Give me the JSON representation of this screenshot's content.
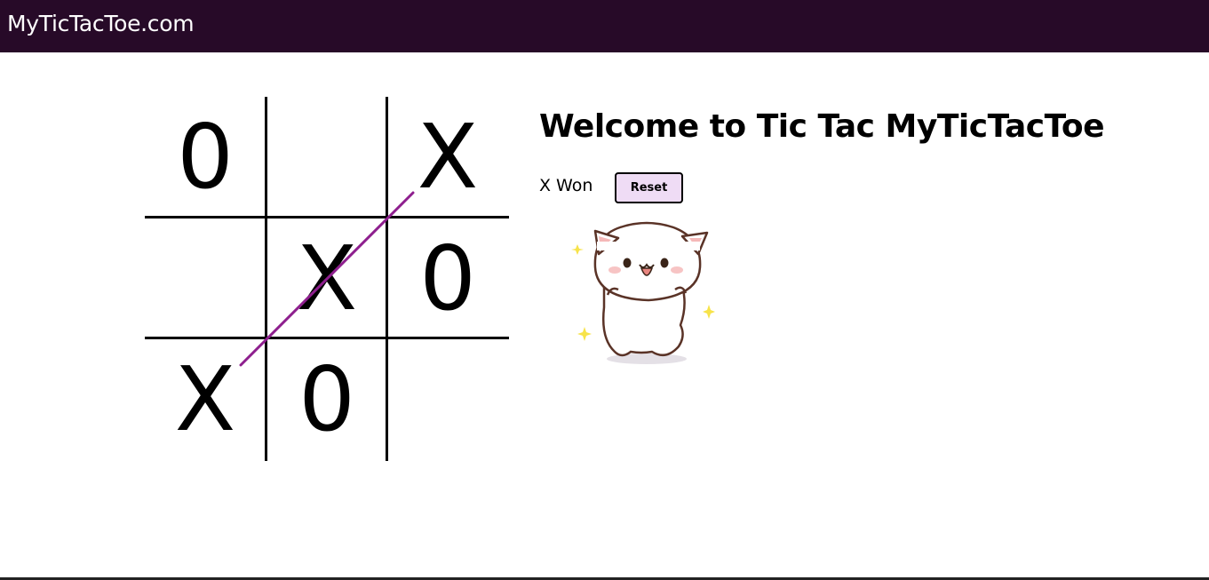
{
  "navbar": {
    "brand": "MyTicTacToe.com"
  },
  "game": {
    "title": "Welcome to Tic Tac MyTicTacToe",
    "status": "X Won",
    "reset_label": "Reset",
    "board": [
      "0",
      "",
      "X",
      "",
      "X",
      "0",
      "X",
      "0",
      ""
    ],
    "winning_line": [
      6,
      4,
      2
    ],
    "win_line_color": "#8e1f8e"
  },
  "celebration": {
    "icon": "happy-cat-sticker-icon"
  },
  "colors": {
    "navbar": "#270a28",
    "reset_bg": "#efdcf5"
  }
}
